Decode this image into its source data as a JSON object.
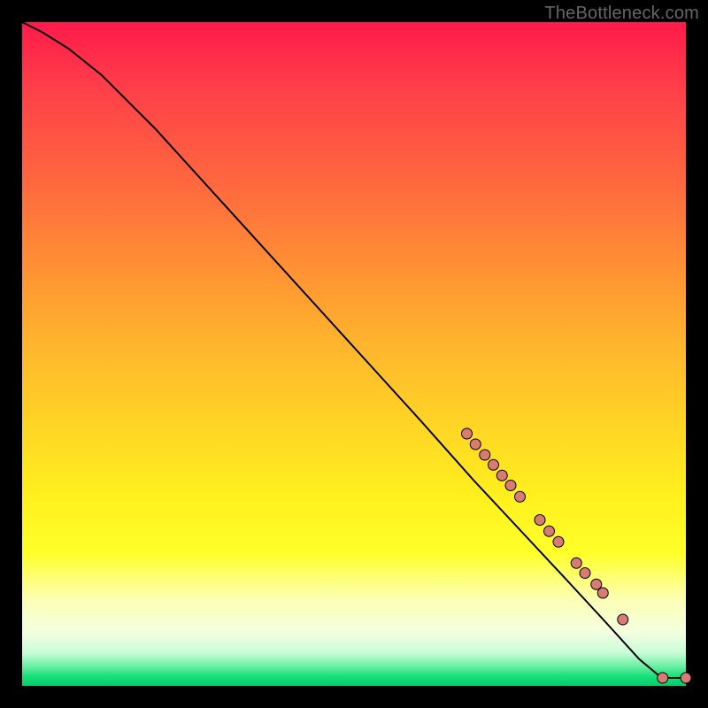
{
  "attribution": "TheBottleneck.com",
  "chart_data": {
    "type": "line",
    "title": "",
    "xlabel": "",
    "ylabel": "",
    "xlim": [
      0,
      100
    ],
    "ylim": [
      0,
      100
    ],
    "grid": false,
    "series": [
      {
        "name": "curve",
        "x": [
          0,
          3,
          7,
          12,
          20,
          30,
          40,
          50,
          60,
          68,
          75,
          82,
          88,
          93,
          96,
          97,
          100
        ],
        "y": [
          100,
          98.5,
          96,
          92,
          84,
          73,
          62,
          51,
          40,
          31,
          23.5,
          16,
          9.5,
          4,
          1.5,
          1.2,
          1.2
        ],
        "stroke": "#000000",
        "stroke_width": 2
      }
    ],
    "markers": [
      {
        "x": 67.0,
        "y": 38.0,
        "r": 6
      },
      {
        "x": 68.3,
        "y": 36.4,
        "r": 6
      },
      {
        "x": 69.7,
        "y": 34.8,
        "r": 6
      },
      {
        "x": 71.0,
        "y": 33.3,
        "r": 6
      },
      {
        "x": 72.3,
        "y": 31.7,
        "r": 6
      },
      {
        "x": 73.6,
        "y": 30.2,
        "r": 6
      },
      {
        "x": 75.0,
        "y": 28.5,
        "r": 6
      },
      {
        "x": 78.0,
        "y": 25.0,
        "r": 6
      },
      {
        "x": 79.4,
        "y": 23.3,
        "r": 6
      },
      {
        "x": 80.8,
        "y": 21.7,
        "r": 6
      },
      {
        "x": 83.5,
        "y": 18.5,
        "r": 6
      },
      {
        "x": 84.8,
        "y": 17.0,
        "r": 6
      },
      {
        "x": 86.5,
        "y": 15.3,
        "r": 6
      },
      {
        "x": 87.5,
        "y": 14.0,
        "r": 6
      },
      {
        "x": 90.5,
        "y": 10.0,
        "r": 6
      },
      {
        "x": 96.5,
        "y": 1.2,
        "r": 6
      },
      {
        "x": 100.0,
        "y": 1.2,
        "r": 6
      }
    ],
    "marker_style": {
      "fill": "#d87c73",
      "stroke": "#000000",
      "stroke_width": 1
    }
  }
}
